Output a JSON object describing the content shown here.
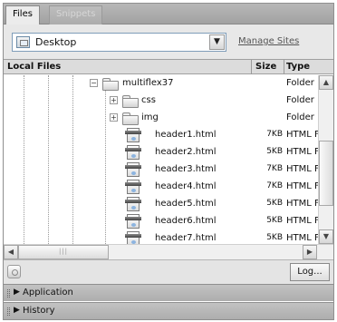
{
  "tabs": [
    {
      "label": "Files",
      "active": true
    },
    {
      "label": "Snippets",
      "active": false
    }
  ],
  "site_selector": {
    "value": "Desktop",
    "icon": "site-icon"
  },
  "manage_sites_label": "Manage Sites",
  "columns": {
    "name": "Local Files",
    "size": "Size",
    "type": "Type"
  },
  "files": [
    {
      "name": "multiflex37",
      "size": "",
      "type": "Folder",
      "kind": "folder",
      "expander": "−"
    },
    {
      "name": "css",
      "size": "",
      "type": "Folder",
      "kind": "folder",
      "expander": "+"
    },
    {
      "name": "img",
      "size": "",
      "type": "Folder",
      "kind": "folder",
      "expander": "+"
    },
    {
      "name": "header1.html",
      "size": "7KB",
      "type": "HTML Fil",
      "kind": "file"
    },
    {
      "name": "header2.html",
      "size": "5KB",
      "type": "HTML Fil",
      "kind": "file"
    },
    {
      "name": "header3.html",
      "size": "7KB",
      "type": "HTML Fil",
      "kind": "file"
    },
    {
      "name": "header4.html",
      "size": "7KB",
      "type": "HTML Fil",
      "kind": "file"
    },
    {
      "name": "header5.html",
      "size": "5KB",
      "type": "HTML Fil",
      "kind": "file"
    },
    {
      "name": "header6.html",
      "size": "5KB",
      "type": "HTML Fil",
      "kind": "file"
    },
    {
      "name": "header7.html",
      "size": "5KB",
      "type": "HTML Fil",
      "kind": "file"
    }
  ],
  "log_button_label": "Log...",
  "collapsed_panels": [
    {
      "label": "Application"
    },
    {
      "label": "History"
    }
  ],
  "colors": {
    "chrome": "#e8e8e8",
    "header_bg": "#dcdcdc",
    "panel_bar": "#b4b4b4"
  }
}
